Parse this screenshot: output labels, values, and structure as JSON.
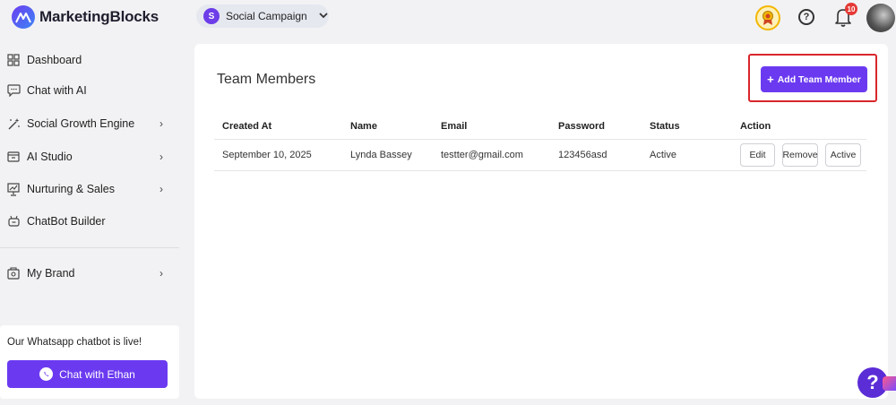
{
  "brand": {
    "name": "MarketingBlocks"
  },
  "campaign": {
    "initial": "S",
    "name": "Social Campaign"
  },
  "header": {
    "notification_count": "10",
    "help_symbol": "?"
  },
  "sidebar": {
    "items": [
      {
        "label": "Dashboard",
        "icon": "grid-icon",
        "has_chevron": false
      },
      {
        "label": "Chat with AI",
        "icon": "chat-icon",
        "has_chevron": false
      },
      {
        "label": "Social Growth Engine",
        "icon": "magic-wand-icon",
        "has_chevron": true
      },
      {
        "label": "AI Studio",
        "icon": "studio-icon",
        "has_chevron": true
      },
      {
        "label": "Nurturing & Sales",
        "icon": "presentation-icon",
        "has_chevron": true
      },
      {
        "label": "ChatBot Builder",
        "icon": "robot-icon",
        "has_chevron": false
      },
      {
        "label": "My Brand",
        "icon": "brand-icon",
        "has_chevron": true
      }
    ],
    "chevron": "›"
  },
  "promo": {
    "text": "Our Whatsapp chatbot is live!",
    "button_label": "Chat with Ethan"
  },
  "main": {
    "title": "Team Members",
    "add_button_label": "Add Team Member",
    "add_button_icon": "+",
    "table": {
      "columns": [
        "Created At",
        "Name",
        "Email",
        "Password",
        "Status",
        "Action"
      ],
      "rows": [
        {
          "created_at": "September 10, 2025",
          "name": "Lynda Bassey",
          "email": "testter@gmail.com",
          "password": "123456asd",
          "status": "Active",
          "actions": [
            "Edit",
            "Remove",
            "Active"
          ]
        }
      ]
    }
  },
  "floating_help": {
    "symbol": "?"
  },
  "colors": {
    "accent": "#6b3af0",
    "highlight": "#d9262c",
    "notification": "#e53935"
  }
}
